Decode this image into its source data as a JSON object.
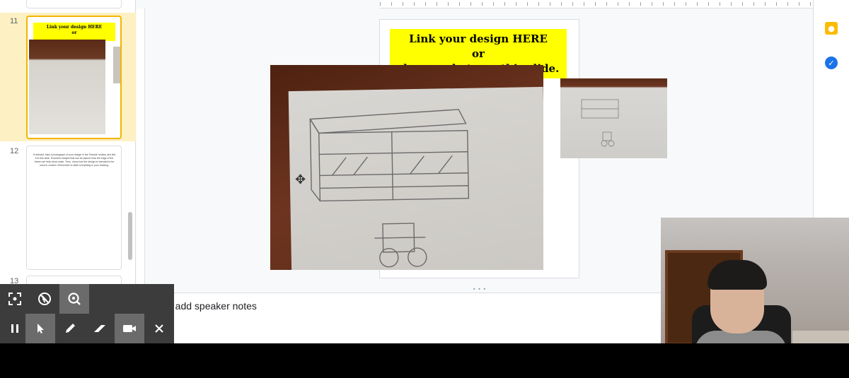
{
  "filmstrip": {
    "slides": [
      {
        "number": "11",
        "banner_line1": "Link your design HERE",
        "banner_line2": "or"
      },
      {
        "number": "12",
        "text": "If relevant, take a photograph of your design in the 'Brands' section and link it to this slide. Rounded shapes that can be placed near the edge of the frame can help show scale. Then, show how the design is intended to be used in context. Remember to label everything in your drawing."
      },
      {
        "number": "13"
      }
    ]
  },
  "slide": {
    "banner_line1": "Link your design HERE",
    "banner_line2": "or",
    "banner_line3": "share a photo on this slide."
  },
  "notes": {
    "placeholder": "o add speaker notes"
  },
  "side_panel": {
    "icons": [
      "keep-icon",
      "tasks-icon"
    ]
  },
  "toolbar": {
    "row1": [
      "capture-region-icon",
      "hide-cursor-icon",
      "zoom-icon"
    ],
    "row2": [
      "pause-icon",
      "pointer-icon",
      "pen-icon",
      "eraser-icon",
      "camera-icon",
      "close-icon"
    ]
  },
  "colors": {
    "banner_yellow": "#ffff00",
    "selected_slide_bg": "#fdf0c2",
    "selected_border": "#f4b400",
    "toolbar_bg": "#3c3c3c"
  }
}
